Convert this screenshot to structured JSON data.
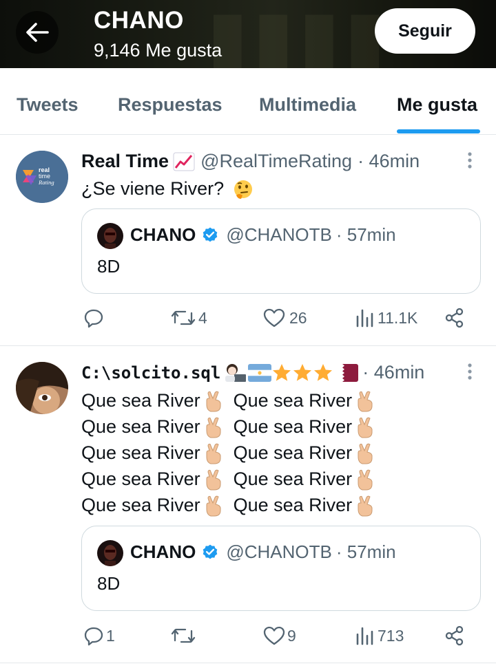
{
  "header": {
    "name": "CHANO",
    "likes_count": "9,146 Me gusta",
    "follow_label": "Seguir"
  },
  "tabs": [
    {
      "label": "Tweets",
      "active": false
    },
    {
      "label": "Respuestas",
      "active": false
    },
    {
      "label": "Multimedia",
      "active": false
    },
    {
      "label": "Me gusta",
      "active": true
    }
  ],
  "colors": {
    "accent": "#1d9bf0",
    "text_primary": "#0f1419",
    "text_secondary": "#536471",
    "divider": "#e3e7ea"
  },
  "tweets": [
    {
      "author_name": "Real Time",
      "author_emoji": "chart-increasing",
      "handle": "@RealTimeRating",
      "time": "· 46min",
      "avatar_text": [
        "real",
        "time",
        "Rating"
      ],
      "text": "¿Se viene River?",
      "text_emoji": "thinking-face",
      "quote": {
        "name": "CHANO",
        "verified": true,
        "handle": "@CHANOTB",
        "time": "· 57min",
        "text": "8D"
      },
      "stats": {
        "replies": "",
        "retweets": "4",
        "likes": "26",
        "views": "11.1K"
      }
    },
    {
      "author_name": "C:\\solcito.sql",
      "author_emojis": [
        "woman-technologist",
        "flag-argentina",
        "star",
        "star",
        "star",
        "flag-qatar"
      ],
      "time": "· 46min",
      "lines": [
        "Que sea River",
        "Que sea River",
        "Que sea River",
        "Que sea River",
        "Que sea River",
        "Que sea River",
        "Que sea River",
        "Que sea River",
        "Que sea River",
        "Que sea River"
      ],
      "line_emoji": "crossed-fingers",
      "quote": {
        "name": "CHANO",
        "verified": true,
        "handle": "@CHANOTB",
        "time": "· 57min",
        "text": "8D"
      },
      "stats": {
        "replies": "1",
        "retweets": "",
        "likes": "9",
        "views": "713"
      }
    }
  ]
}
